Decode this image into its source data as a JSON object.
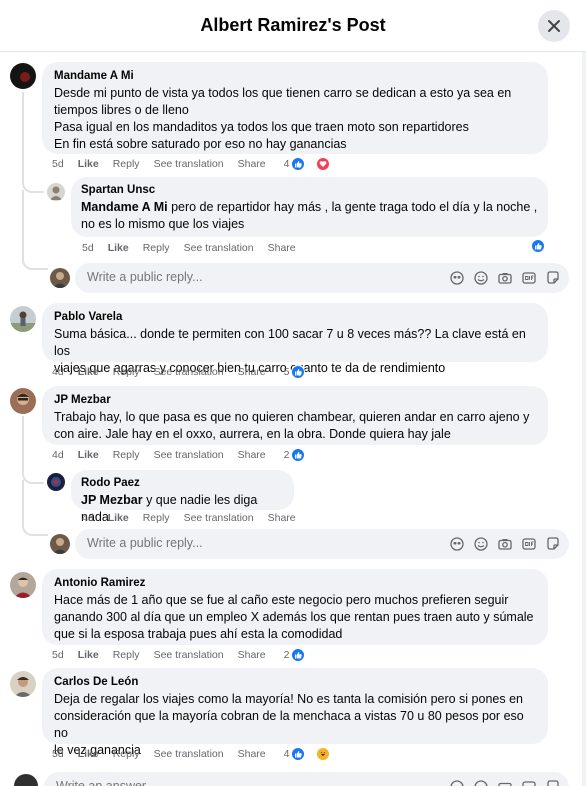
{
  "header": {
    "title": "Albert Ramirez's Post",
    "close_icon": "close-icon"
  },
  "comments": [
    {
      "author": "Mandame A Mi",
      "lines": [
        "Desde mi punto de vista ya todos los que tienen carro se dedican a esto ya sea en",
        "tiempos libres o de lleno",
        "Pasa igual en los mandaditos ya todos los que traen moto son repartidores",
        "En fin está sobre saturado por eso no hay ganancias"
      ],
      "time": "5d",
      "like": "Like",
      "reply": "Reply",
      "translate": "See translation",
      "share": "Share",
      "reaction_count": "4",
      "reactions": [
        "like",
        "love"
      ]
    },
    {
      "author": "Spartan Unsc",
      "mention": "Mandame A Mi",
      "lines": [
        " pero de repartidor hay más , la gente traga todo el día y la noche ,",
        "no es lo mismo que los viajes"
      ],
      "time": "5d",
      "like": "Like",
      "reply": "Reply",
      "translate": "See translation",
      "share": "Share",
      "reactions": [
        "like"
      ]
    },
    {
      "author": "Pablo Varela",
      "lines": [
        "Suma básica... donde te permiten con 100 sacar 7 u 8 veces más?? La clave está en los",
        "viajes que agarras y conocer bien tu carro cuanto te da de rendimiento"
      ],
      "time": "4d",
      "like": "Like",
      "reply": "Reply",
      "translate": "See translation",
      "share": "Share",
      "reaction_count": "5",
      "reactions": [
        "like"
      ]
    },
    {
      "author": "JP Mezbar",
      "lines": [
        "Trabajo hay, lo que pasa es que no quieren chambear, quieren andar en carro ajeno y",
        "con aire. Jale hay en el oxxo, aurrera, en la obra. Donde quiera hay jale"
      ],
      "time": "4d",
      "like": "Like",
      "reply": "Reply",
      "translate": "See translation",
      "share": "Share",
      "reaction_count": "2",
      "reactions": [
        "like"
      ]
    },
    {
      "author": "Rodo Paez",
      "mention": "JP Mezbar",
      "lines": [
        " y que nadie les diga nada"
      ],
      "time": "4d",
      "like": "Like",
      "reply": "Reply",
      "translate": "See translation",
      "share": "Share"
    },
    {
      "author": "Antonio Ramirez",
      "lines": [
        "Hace más de 1 año que se fue al caño este negocio pero muchos prefieren seguir",
        "ganando 300 al día que un empleo X además los que rentan pues traen auto y súmale",
        "que si la esposa trabaja pues ahí esta la comodidad"
      ],
      "time": "5d",
      "like": "Like",
      "reply": "Reply",
      "translate": "See translation",
      "share": "Share",
      "reaction_count": "2",
      "reactions": [
        "like"
      ]
    },
    {
      "author": "Carlos De León",
      "lines": [
        "Deja de regalar los viajes como la mayoría! No es tanta la comisión pero si pones en",
        "consideración que la mayoría cobran de la menchaca a vistas 70 u 80 pesos por eso no",
        "le vez ganancia"
      ],
      "time": "5d",
      "like": "Like",
      "reply": "Reply",
      "translate": "See translation",
      "share": "Share",
      "reaction_count": "4",
      "reactions": [
        "like",
        "haha"
      ]
    }
  ],
  "reply_box": {
    "placeholder": "Write a public reply...",
    "icons": [
      "avatar-sticker-icon",
      "emoji-icon",
      "camera-icon",
      "gif-icon",
      "sticker-icon"
    ]
  },
  "answer_box": {
    "placeholder": "Write an answer..."
  },
  "colors": {
    "bubble": "#f0f2f5",
    "meta": "#65676b",
    "like_blue": "#1877f2",
    "love_red": "#f33e58"
  }
}
